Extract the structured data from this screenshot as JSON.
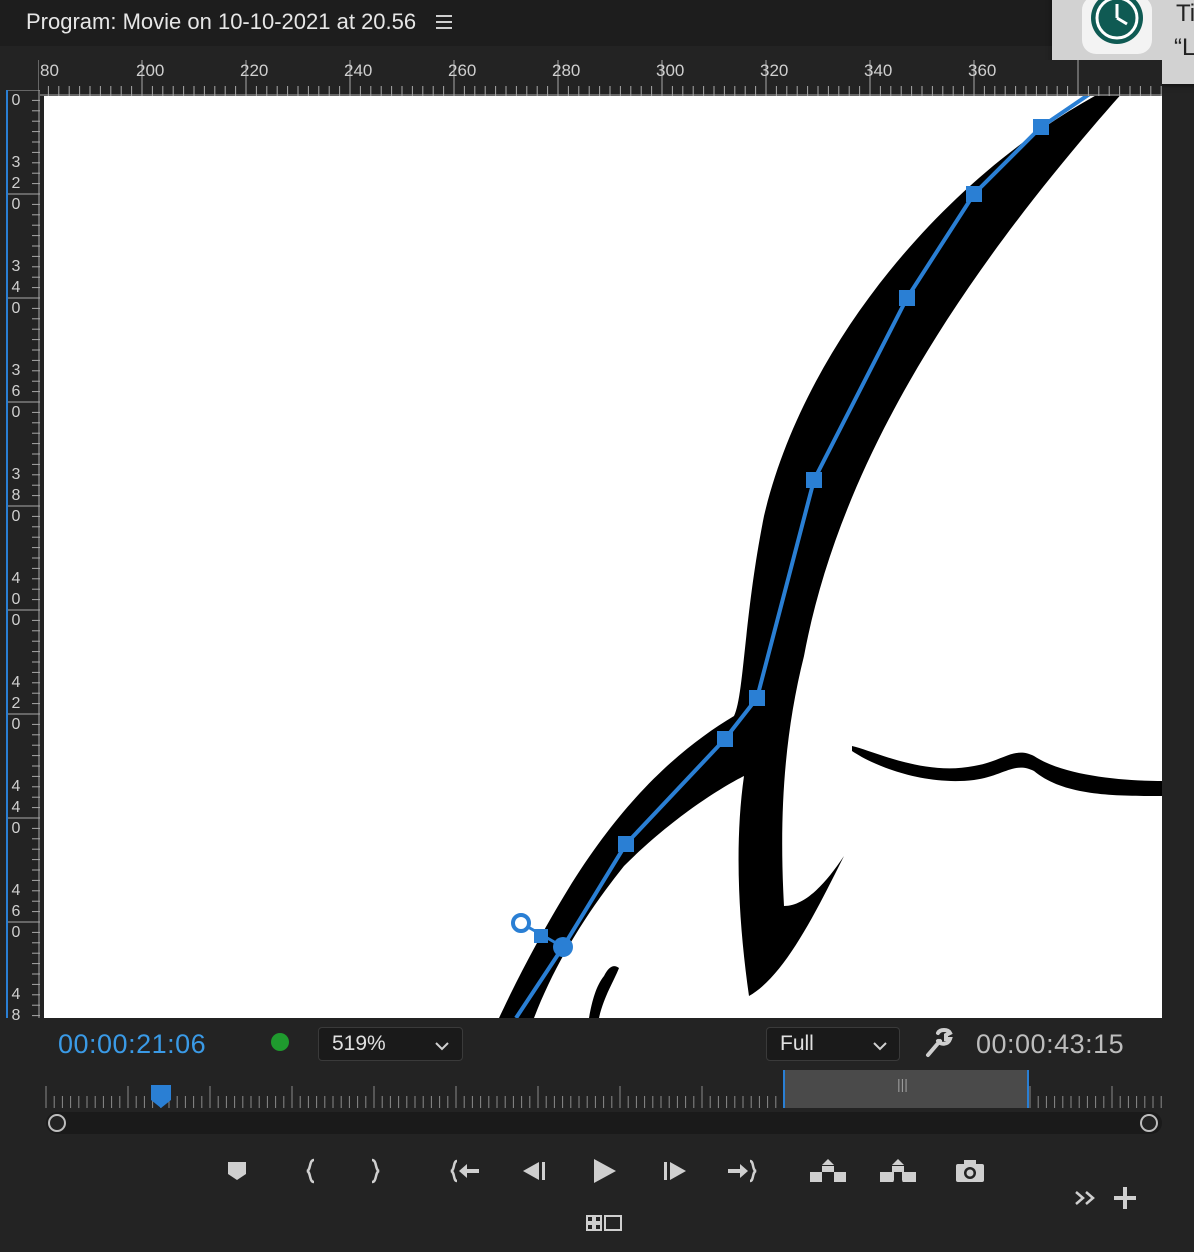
{
  "window": {
    "title": "Program: Movie on 10-10-2021 at 20.56"
  },
  "notification": {
    "line1": "Ti",
    "line2": "“L"
  },
  "ruler": {
    "horizontal_labels": [
      "80",
      "200",
      "220",
      "240",
      "260",
      "280",
      "300",
      "320",
      "340",
      "360"
    ],
    "vertical_labels": [
      "0",
      "320",
      "340",
      "360",
      "380",
      "400",
      "420",
      "440",
      "460",
      "48"
    ]
  },
  "controls": {
    "current_time": "00:00:21:06",
    "zoom_level": "519%",
    "resolution": "Full",
    "duration": "00:00:43:15"
  },
  "colors": {
    "accent": "#2a7fd4",
    "timecode": "#3a9ae6",
    "status_dot": "#1f9a2e",
    "panel_bg": "#232323"
  },
  "transport_icons": [
    "marker-icon",
    "mark-in-icon",
    "mark-out-icon",
    "go-to-in-icon",
    "step-back-icon",
    "play-icon",
    "step-forward-icon",
    "go-to-out-icon",
    "lift-icon",
    "extract-icon",
    "export-frame-icon"
  ]
}
